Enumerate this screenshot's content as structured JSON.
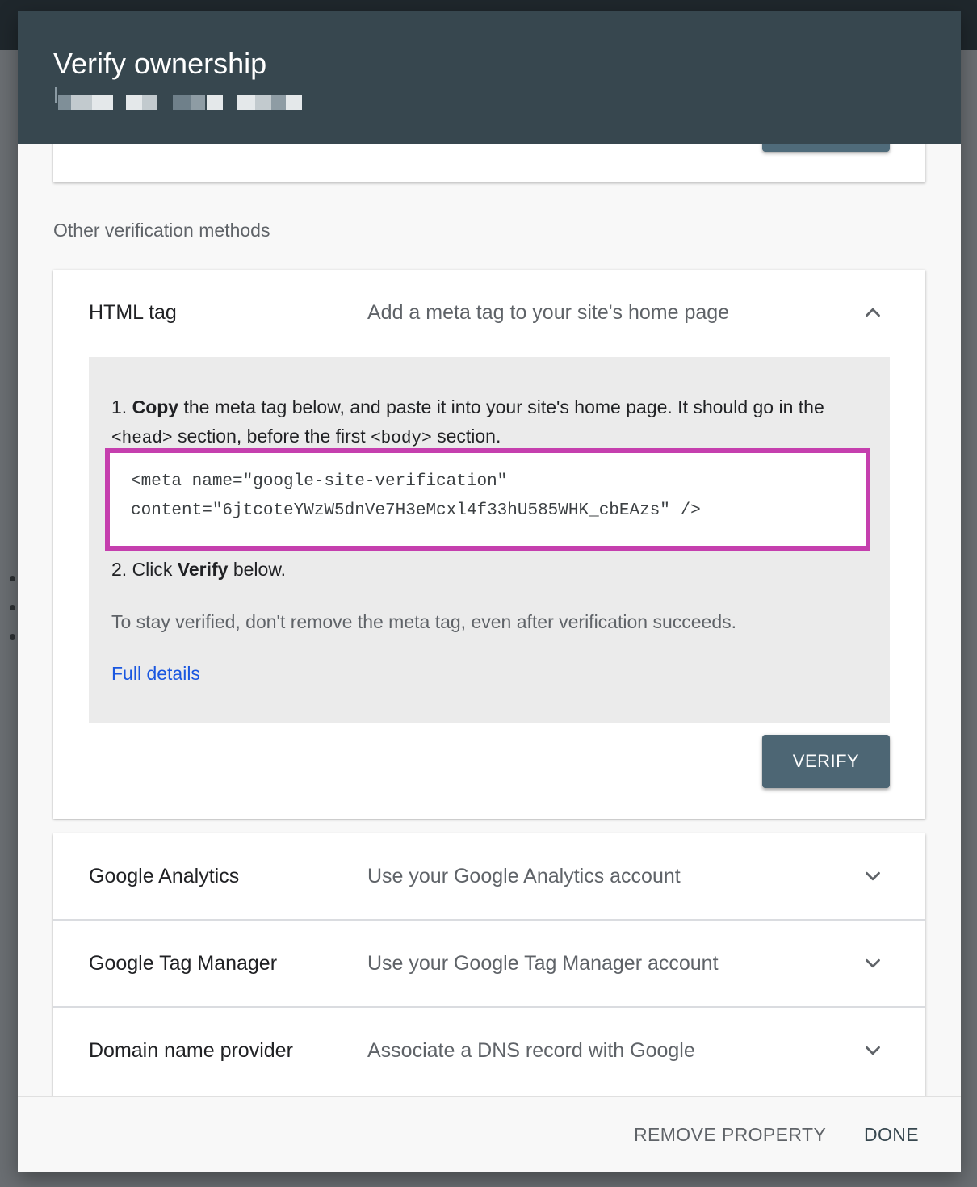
{
  "dialog": {
    "title": "Verify ownership"
  },
  "other_methods": {
    "label": "Other verification methods"
  },
  "html_tag": {
    "name": "HTML tag",
    "description": "Add a meta tag to your site's home page",
    "step1": {
      "num": "1.",
      "bold": "Copy",
      "text_a": " the meta tag below, and paste it into your site's home page. It should go in the ",
      "code_head": "<head>",
      "text_b": " section, before the first ",
      "code_body": "<body>",
      "text_c": " section."
    },
    "meta_line1": "<meta name=\"google-site-verification\"",
    "meta_line2": "content=\"6jtcoteYWzW5dnVe7H3eMcxl4f33hU585WHK_cbEAzs\" />",
    "step2": {
      "prefix": "2. Click ",
      "bold": "Verify",
      "suffix": " below."
    },
    "stay_note": "To stay verified, don't remove the meta tag, even after verification succeeds.",
    "details_link": "Full details",
    "verify_label": "VERIFY"
  },
  "methods": [
    {
      "name": "Google Analytics",
      "description": "Use your Google Analytics account"
    },
    {
      "name": "Google Tag Manager",
      "description": "Use your Google Tag Manager account"
    },
    {
      "name": "Domain name provider",
      "description": "Associate a DNS record with Google"
    }
  ],
  "footer": {
    "remove_label": "REMOVE PROPERTY",
    "done_label": "DONE"
  },
  "icons": {
    "expanded": "chevron-up-icon",
    "collapsed": "chevron-down-icon"
  },
  "colors": {
    "header": "#37474f",
    "button": "#4d6674",
    "highlight": "#c53fae",
    "link": "#1a57e0"
  }
}
